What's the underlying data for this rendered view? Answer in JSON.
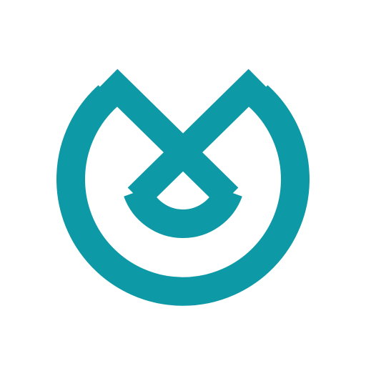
{
  "logo": {
    "icon": "teal-circular-x-logo-icon",
    "color": "#0e99a6",
    "background": "#ffffff"
  }
}
